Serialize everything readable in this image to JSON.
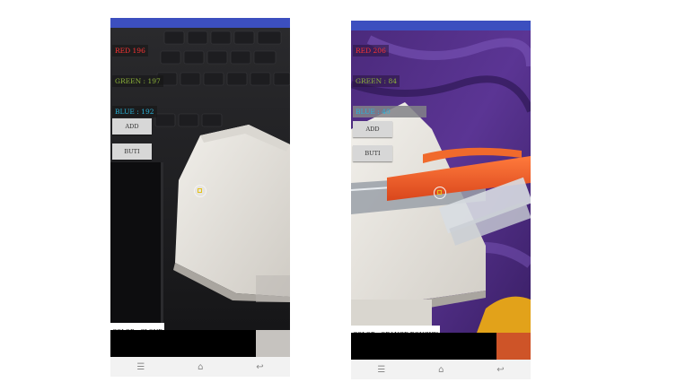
{
  "colors": {
    "statusbar": "#3c4fbf",
    "red_label": "#ff3434",
    "green_label": "#8db33a",
    "blue_label": "#2ab3d9",
    "crosshair_ring": "#f4f4f4",
    "crosshair_square": "#e4c21a"
  },
  "screens": [
    {
      "readouts": {
        "red": "RED    196",
        "green": "GREEN : 197",
        "blue": "BLUE  : 192"
      },
      "buttons": {
        "add": "ADD",
        "second": "BUTI"
      },
      "color_name": "COLOR :    CLOUD",
      "swatch_color": "#c6c3bf",
      "nav_icons": [
        "menu-icon",
        "home-icon",
        "back-icon"
      ]
    },
    {
      "readouts": {
        "red": "RED    206",
        "green": "GREEN : 84",
        "blue": "BLUE  : 40"
      },
      "buttons": {
        "add": "ADD",
        "second": "BUTI"
      },
      "color_name": "COLOR :   ORANGE ROUGHY",
      "swatch_color": "#ce5428",
      "nav_icons": [
        "menu-icon",
        "home-icon",
        "back-icon"
      ]
    }
  ],
  "nav_glyphs": {
    "menu": "☰",
    "home": "⌂",
    "back": "↩"
  }
}
